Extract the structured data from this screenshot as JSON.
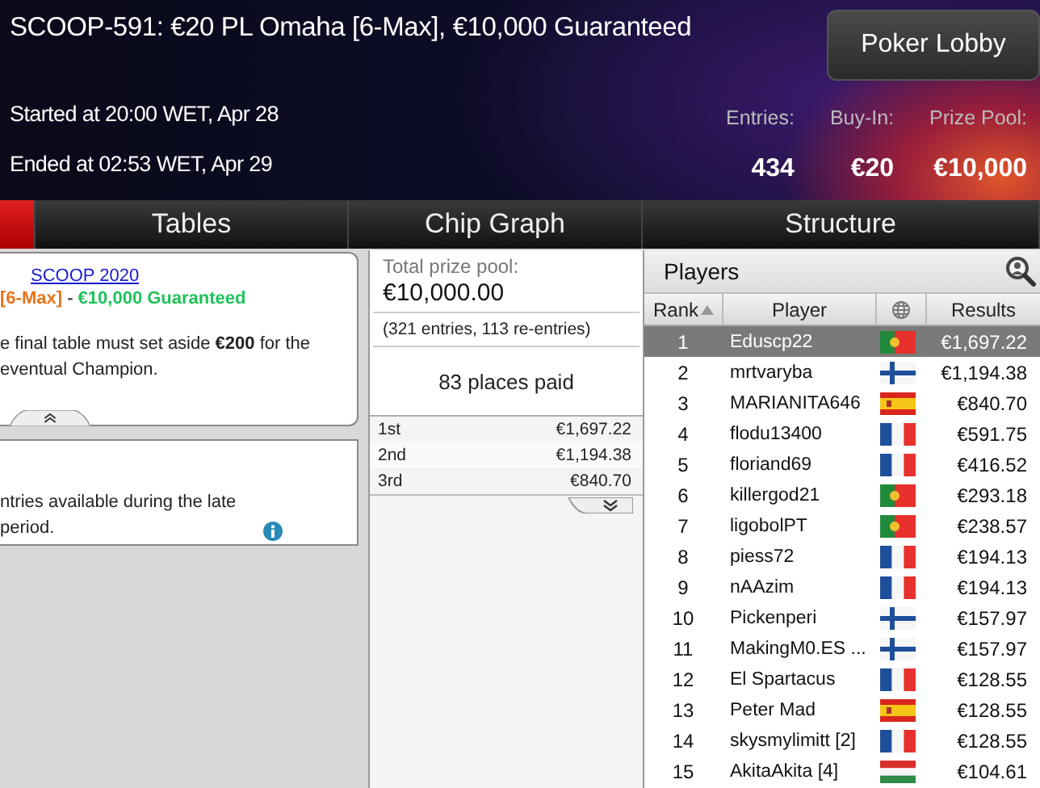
{
  "header": {
    "title": "SCOOP-591: €20 PL Omaha [6-Max], €10,000 Guaranteed",
    "lobby_button": "Poker Lobby",
    "started": "Started at 20:00 WET, Apr 28",
    "ended": "Ended at 02:53 WET, Apr 29",
    "stats": [
      {
        "label": "Entries:",
        "value": "434"
      },
      {
        "label": "Buy-In:",
        "value": "€20"
      },
      {
        "label": "Prize Pool:",
        "value": "€10,000"
      }
    ]
  },
  "tabs": [
    {
      "selected": true
    },
    {
      "label": "Tables",
      "selected": false
    },
    {
      "label": "Chip Graph",
      "selected": false
    },
    {
      "label": "Structure",
      "selected": false
    }
  ],
  "info_card": {
    "link": "SCOOP 2020",
    "subtitle": [
      {
        "kind": "format",
        "text": "[6-Max]"
      },
      {
        "kind": "separator",
        "text": " - "
      },
      {
        "kind": "guarantee",
        "text": "€10,000 Guaranteed"
      }
    ],
    "note": "e final table must set aside **€200** for the eventual Champion."
  },
  "reentry_card": {
    "note": "ntries available during the late period."
  },
  "prizes": {
    "label": "Total prize pool:",
    "total": "€10,000.00",
    "entries": "(321 entries, 113 re-entries)",
    "places": "83 places paid",
    "rows": [
      {
        "place": "1st",
        "amount": "€1,697.22"
      },
      {
        "place": "2nd",
        "amount": "€1,194.38"
      },
      {
        "place": "3rd",
        "amount": "€840.70"
      }
    ]
  },
  "players": {
    "title": "Players",
    "columns": [
      "Rank",
      "Player",
      "Results"
    ],
    "rows": [
      {
        "rank": "1",
        "name": "Eduscp22",
        "kind": "pt",
        "result": "€1,697.22",
        "selected": true
      },
      {
        "rank": "2",
        "name": "mrtvaryba",
        "kind": "fi",
        "result": "€1,194.38",
        "selected": false
      },
      {
        "rank": "3",
        "name": "MARIANITA646",
        "kind": "es",
        "result": "€840.70",
        "selected": false
      },
      {
        "rank": "4",
        "name": "flodu13400",
        "kind": "fr",
        "result": "€591.75",
        "selected": false
      },
      {
        "rank": "5",
        "name": "floriand69",
        "kind": "fr",
        "result": "€416.52",
        "selected": false
      },
      {
        "rank": "6",
        "name": "killergod21",
        "kind": "pt",
        "result": "€293.18",
        "selected": false
      },
      {
        "rank": "7",
        "name": "ligobolPT",
        "kind": "pt",
        "result": "€238.57",
        "selected": false
      },
      {
        "rank": "8",
        "name": "piess72",
        "kind": "fr",
        "result": "€194.13",
        "selected": false
      },
      {
        "rank": "9",
        "name": "nAAzim",
        "kind": "fr",
        "result": "€194.13",
        "selected": false
      },
      {
        "rank": "10",
        "name": "Pickenperi",
        "kind": "fi",
        "result": "€157.97",
        "selected": false
      },
      {
        "rank": "11",
        "name": "MakingM0.ES ...",
        "kind": "fi",
        "result": "€157.97",
        "selected": false
      },
      {
        "rank": "12",
        "name": "El Spartacus",
        "kind": "fr",
        "result": "€128.55",
        "selected": false
      },
      {
        "rank": "13",
        "name": "Peter Mad",
        "kind": "es",
        "result": "€128.55",
        "selected": false
      },
      {
        "rank": "14",
        "name": "skysmylimitt [2]",
        "kind": "fr",
        "result": "€128.55",
        "selected": false
      },
      {
        "rank": "15",
        "name": "AkitaAkita [4]",
        "kind": "hu",
        "result": "€104.61",
        "selected": false
      }
    ]
  }
}
